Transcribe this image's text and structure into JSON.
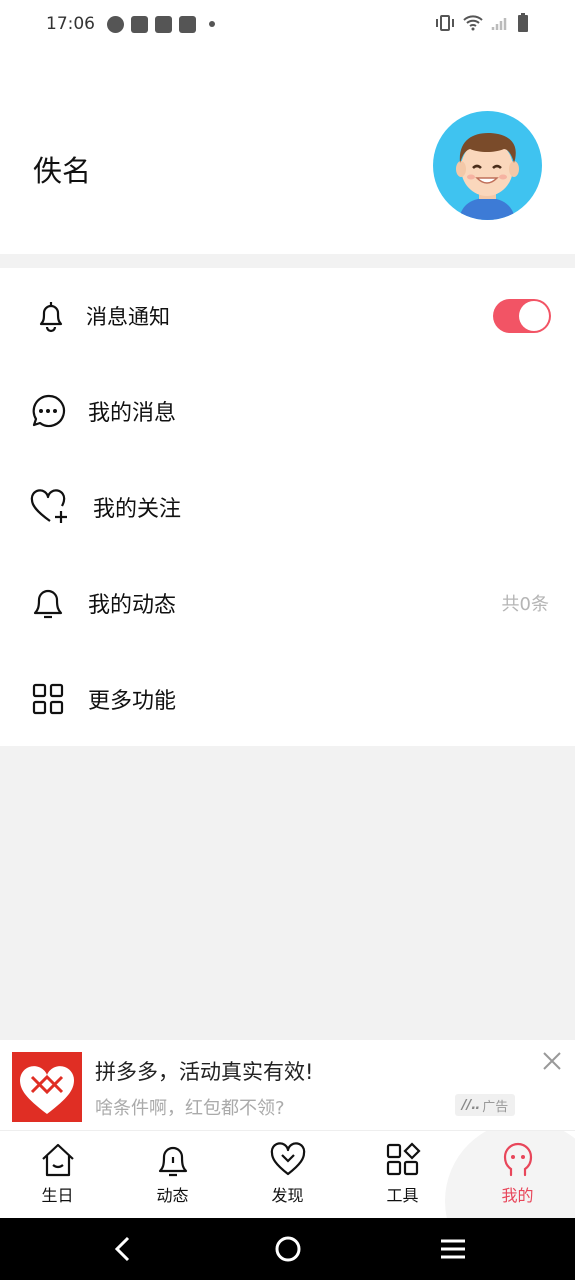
{
  "status_bar": {
    "time": "17:06"
  },
  "profile": {
    "name": "佚名"
  },
  "menu": {
    "notifications": {
      "label": "消息通知",
      "enabled": true
    },
    "messages": {
      "label": "我的消息"
    },
    "following": {
      "label": "我的关注"
    },
    "activity": {
      "label": "我的动态",
      "count_text": "共0条"
    },
    "more": {
      "label": "更多功能"
    }
  },
  "ad": {
    "title": "拼多多，活动真实有效!",
    "subtitle": "啥条件啊，红包都不领?",
    "badge": "广告"
  },
  "tabs": [
    {
      "label": "生日",
      "icon": "home-icon"
    },
    {
      "label": "动态",
      "icon": "bell-icon"
    },
    {
      "label": "发现",
      "icon": "heart-icon"
    },
    {
      "label": "工具",
      "icon": "tools-icon"
    },
    {
      "label": "我的",
      "icon": "profile-icon",
      "active": true
    }
  ],
  "colors": {
    "accent": "#e8465a",
    "toggle": "#f25465",
    "avatar_bg": "#3fc3f0"
  }
}
